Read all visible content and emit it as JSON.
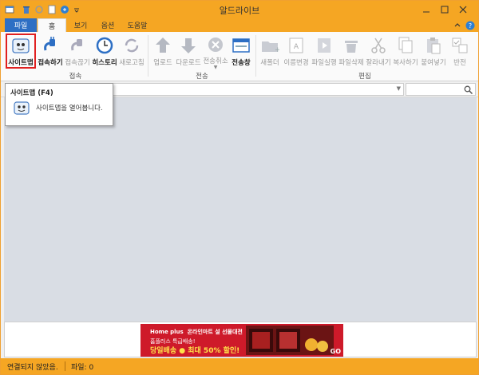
{
  "window": {
    "title": "알드라이브"
  },
  "tabs": {
    "file": "파일",
    "items": [
      "홈",
      "보기",
      "옵션",
      "도움말"
    ],
    "active": 0
  },
  "ribbon": {
    "groups": {
      "connect": {
        "label": "접속",
        "buttons": [
          {
            "label": "사이트맵",
            "icon": "sitemap-icon"
          },
          {
            "label": "접속하기",
            "icon": "plug-connect-icon"
          },
          {
            "label": "접속끊기",
            "icon": "plug-disconnect-icon"
          },
          {
            "label": "히스토리",
            "icon": "clock-icon"
          },
          {
            "label": "새로고침",
            "icon": "refresh-icon"
          }
        ]
      },
      "transfer": {
        "label": "전송",
        "buttons": [
          {
            "label": "업로드",
            "icon": "upload-arrow-icon"
          },
          {
            "label": "다운로드",
            "icon": "download-arrow-icon"
          },
          {
            "label": "전송취소",
            "icon": "cancel-circle-icon"
          },
          {
            "label": "전송창",
            "icon": "transfer-window-icon"
          }
        ]
      },
      "edit": {
        "label": "편집",
        "buttons": [
          {
            "label": "새폴더",
            "icon": "new-folder-icon"
          },
          {
            "label": "이름변경",
            "icon": "rename-icon"
          },
          {
            "label": "파일실행",
            "icon": "run-file-icon"
          },
          {
            "label": "파일삭제",
            "icon": "trash-icon"
          },
          {
            "label": "잘라내기",
            "icon": "scissors-icon"
          },
          {
            "label": "복사하기",
            "icon": "copy-icon"
          },
          {
            "label": "붙여넣기",
            "icon": "paste-icon"
          },
          {
            "label": "반전",
            "icon": "invert-selection-icon"
          }
        ]
      }
    }
  },
  "tooltip": {
    "title": "사이트맵 (F4)",
    "text": "사이트맵을 열어봅니다."
  },
  "ad": {
    "brand": "Home plus",
    "line0": "온라인마트 설 선물대전",
    "line1": "홈플러스 특급배송!",
    "line2": "당일배송 ● 최대 50% 할인!",
    "go": "GO"
  },
  "status": {
    "connection": "연결되지 않았음.",
    "files": "파일: 0"
  },
  "colors": {
    "accent": "#f5a623",
    "file_tab": "#2d6fc4",
    "main_bg": "#d9dde4",
    "ad_red": "#ce1a2a"
  }
}
